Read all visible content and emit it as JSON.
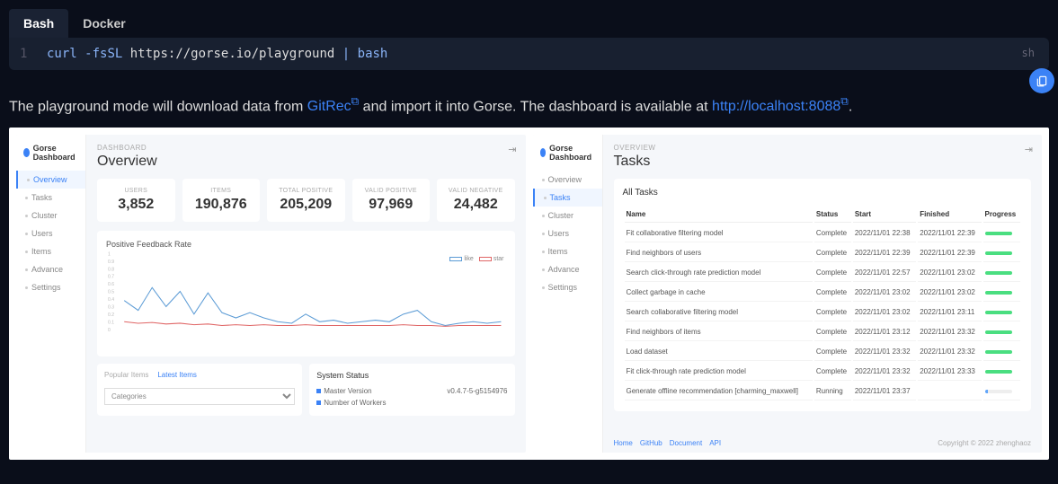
{
  "tabs": {
    "bash": "Bash",
    "docker": "Docker"
  },
  "code": {
    "lang": "sh",
    "line_no": "1",
    "cmd_curl": "curl",
    "cmd_flags": "-fsSL",
    "cmd_url": "https://gorse.io/playground",
    "cmd_pipe": "|",
    "cmd_bash": "bash"
  },
  "desc": {
    "pre": "The playground mode will download data from ",
    "link1": "GitRec",
    "mid": " and import it into Gorse. The dashboard is available at ",
    "link2": "http://localhost:8088",
    "post": "."
  },
  "sidebar": {
    "logo": "Gorse Dashboard",
    "items": [
      "Overview",
      "Tasks",
      "Cluster",
      "Users",
      "Items",
      "Advance",
      "Settings"
    ]
  },
  "overview": {
    "crumb": "DASHBOARD",
    "title": "Overview",
    "stats": [
      {
        "label": "USERS",
        "value": "3,852"
      },
      {
        "label": "ITEMS",
        "value": "190,876"
      },
      {
        "label": "TOTAL POSITIVE",
        "value": "205,209"
      },
      {
        "label": "VALID POSITIVE",
        "value": "97,969"
      },
      {
        "label": "VALID NEGATIVE",
        "value": "24,482"
      }
    ],
    "chart_title": "Positive Feedback Rate",
    "legend": {
      "a": "like",
      "b": "star"
    },
    "pop_tabs": {
      "a": "Popular Items",
      "b": "Latest Items"
    },
    "pop_select": "Categories",
    "sys_title": "System Status",
    "sys_rows": [
      {
        "k": "Master Version",
        "v": "v0.4.7-5-g5154976"
      },
      {
        "k": "Number of Workers",
        "v": ""
      }
    ]
  },
  "tasks": {
    "crumb": "OVERVIEW",
    "title": "Tasks",
    "subtitle": "All Tasks",
    "cols": {
      "name": "Name",
      "status": "Status",
      "start": "Start",
      "finished": "Finished",
      "progress": "Progress"
    },
    "rows": [
      {
        "name": "Fit collaborative filtering model",
        "status": "Complete",
        "start": "2022/11/01 22:38",
        "finished": "2022/11/01 22:39",
        "full": true
      },
      {
        "name": "Find neighbors of users",
        "status": "Complete",
        "start": "2022/11/01 22:39",
        "finished": "2022/11/01 22:39",
        "full": true
      },
      {
        "name": "Search click-through rate prediction model",
        "status": "Complete",
        "start": "2022/11/01 22:57",
        "finished": "2022/11/01 23:02",
        "full": true
      },
      {
        "name": "Collect garbage in cache",
        "status": "Complete",
        "start": "2022/11/01 23:02",
        "finished": "2022/11/01 23:02",
        "full": true
      },
      {
        "name": "Search collaborative filtering model",
        "status": "Complete",
        "start": "2022/11/01 23:02",
        "finished": "2022/11/01 23:11",
        "full": true
      },
      {
        "name": "Find neighbors of items",
        "status": "Complete",
        "start": "2022/11/01 23:12",
        "finished": "2022/11/01 23:32",
        "full": true
      },
      {
        "name": "Load dataset",
        "status": "Complete",
        "start": "2022/11/01 23:32",
        "finished": "2022/11/01 23:32",
        "full": true
      },
      {
        "name": "Fit click-through rate prediction model",
        "status": "Complete",
        "start": "2022/11/01 23:32",
        "finished": "2022/11/01 23:33",
        "full": true
      },
      {
        "name": "Generate offline recommendation [charming_maxwell]",
        "status": "Running",
        "start": "2022/11/01 23:37",
        "finished": "",
        "full": false
      }
    ],
    "footer_links": [
      "Home",
      "GitHub",
      "Document",
      "API"
    ],
    "copyright": "Copyright © 2022 zhenghaoz"
  },
  "chart_data": {
    "type": "line",
    "title": "Positive Feedback Rate",
    "ylim": [
      0,
      1
    ],
    "yticks": [
      0,
      0.1,
      0.2,
      0.3,
      0.4,
      0.5,
      0.6,
      0.7,
      0.8,
      0.9,
      1
    ],
    "series": [
      {
        "name": "like",
        "color": "#5b9bd5",
        "values": [
          0.38,
          0.25,
          0.55,
          0.3,
          0.5,
          0.2,
          0.48,
          0.22,
          0.15,
          0.22,
          0.15,
          0.1,
          0.08,
          0.2,
          0.1,
          0.12,
          0.08,
          0.1,
          0.12,
          0.1,
          0.2,
          0.25,
          0.1,
          0.05,
          0.08,
          0.1,
          0.08,
          0.1
        ]
      },
      {
        "name": "star",
        "color": "#e06666",
        "values": [
          0.1,
          0.08,
          0.09,
          0.07,
          0.08,
          0.06,
          0.07,
          0.05,
          0.06,
          0.05,
          0.06,
          0.05,
          0.05,
          0.06,
          0.05,
          0.05,
          0.05,
          0.05,
          0.05,
          0.05,
          0.06,
          0.05,
          0.05,
          0.04,
          0.05,
          0.05,
          0.05,
          0.05
        ]
      }
    ]
  }
}
